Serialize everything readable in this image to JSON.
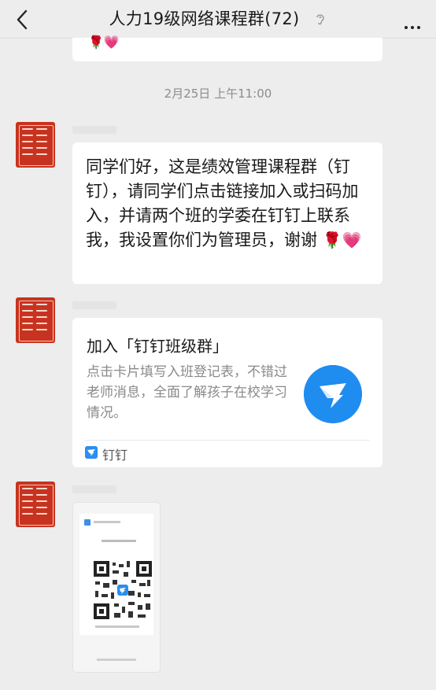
{
  "header": {
    "title": "人力19级网络课程群(72)"
  },
  "messages": {
    "timestamp": "2月25日 上午11:00",
    "text_message": {
      "body": "同学们好，这是绩效管理课程群（钉钉），请同学们点击链接加入或扫码加入，并请两个班的学委在钉钉上联系我，我设置你们为管理员，谢谢",
      "emojis": "🌹💗"
    },
    "card_message": {
      "title": "加入「钉钉班级群」",
      "description": "点击卡片填写入班登记表，不错过老师消息，全面了解孩子在校学习情况。",
      "source": "钉钉"
    }
  },
  "colors": {
    "background": "#ededed",
    "bubble": "#ffffff",
    "avatar_red": "#c8331f",
    "dingtalk_blue": "#1f8cf0"
  },
  "icons": [
    "back-arrow-icon",
    "ear-mute-icon",
    "more-icon",
    "dingtalk-logo-icon",
    "qr-code-icon"
  ]
}
